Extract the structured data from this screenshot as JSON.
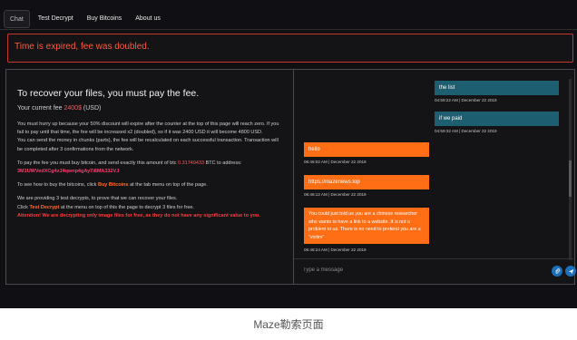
{
  "nav": {
    "items": [
      "Chat",
      "Test Decrypt",
      "Buy Bitcoins",
      "About us"
    ]
  },
  "alert": {
    "text": "Time is expired, fee was doubled."
  },
  "left": {
    "heading": "To recover your files, you must pay the fee.",
    "fee_prefix": "Your current fee ",
    "fee_amount": "2400$",
    "fee_suffix": " (USD)",
    "para1": "You must hurry up because your 50% discount will expire after the counter at the top of this page will reach zero. If you fail to pay until that time, the fee will be increased x2 (doubled), so if it was 2400 USD it will become 4800 USD.",
    "para2": "You can send the money in chunks (parts), the fee will be recalculated on each successful transaction. Transaction will be completed after 3 confirmations from the network.",
    "pay_prefix": "To pay the fee you must buy bitcoin, and send exactly this amount of btc ",
    "btc_amount": "0.31749433",
    "pay_suffix": " BTC to address:",
    "btc_address": "3M1UWVedXCg4zJ4qwnp4gAy7i8MA332VJ",
    "howto_prefix": "To see how to buy the bitcoins, click ",
    "howto_link": "Buy Bitcoins",
    "howto_suffix": " at the tab menu on top of the page.",
    "test1": "We are providing 3 test decrypts, to prove that we can recover your files.",
    "test2_prefix": "Click ",
    "test2_link": "Test Decrypt",
    "test2_suffix": " at the menu on top of this the page to decrypt 3 files for free.",
    "attention": "Attention! We are decrypting only image files for free, as they do not have any significant value to you."
  },
  "chat": {
    "messages": [
      {
        "text": "the list",
        "time": "04:59:22 AM | December 22 2019",
        "side": "right"
      },
      {
        "text": "if we paid",
        "time": "04:59:32 AM | December 22 2019",
        "side": "right"
      },
      {
        "text": "hello",
        "time": "06:46:02 AM | December 22 2019",
        "side": "left"
      },
      {
        "text": "https://mazenews.top",
        "time": "06:46:12 AM | December 22 2019",
        "side": "left"
      },
      {
        "text": "You could just told us you are a chinese researcher who wants to have a link to a website. It is not a problem to us. There is no need to pretend you are a \"victim\"",
        "time": "06:48:24 AM | December 22 2019",
        "side": "left"
      }
    ],
    "input_placeholder": "Type a message"
  },
  "colors": {
    "page_bg": "#101014",
    "alert_text": "#ff5a3c",
    "bubble_teal": "#1d5e70",
    "bubble_orange": "#ff6d15",
    "button_blue": "#1d6fb8"
  },
  "icons": [
    "attach-icon",
    "send-icon"
  ],
  "caption": "Maze勒索页面"
}
